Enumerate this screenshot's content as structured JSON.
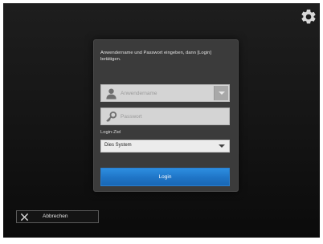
{
  "header": {
    "settings_icon": "gear-icon"
  },
  "login": {
    "instruction": "Anwendername und Passwort eingeben, dann [Login] betätigen.",
    "username": {
      "placeholder": "Anwendername",
      "value": "",
      "icon": "user-icon"
    },
    "password": {
      "placeholder": "Passwort",
      "value": "",
      "icon": "key-icon"
    },
    "target_label": "Login-Ziel",
    "target_value": "Dies System",
    "submit_label": "Login"
  },
  "footer": {
    "cancel_label": "Abbrechen",
    "cancel_icon": "close-icon"
  },
  "colors": {
    "background": "#161616",
    "panel": "#3b3b3b",
    "accent": "#1f74c6"
  }
}
